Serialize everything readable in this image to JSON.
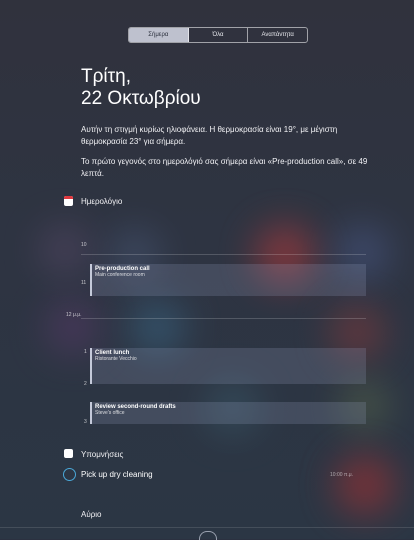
{
  "tabs": [
    {
      "label": "Σήμερα",
      "active": true
    },
    {
      "label": "Όλα",
      "active": false
    },
    {
      "label": "Αναπάντητα",
      "active": false
    }
  ],
  "date": {
    "weekday": "Τρίτη,",
    "day_month": "22 Οκτωβρίου"
  },
  "summary": {
    "weather": "Αυτήν τη στιγμή κυρίως ηλιοφάνεια. Η θερμοκρασία είναι 19°, με μέγιστη θερμοκρασία 23° για σήμερα.",
    "calendar": "Το πρώτο γεγονός στο ημερολόγιό σας σήμερα είναι «Pre-production call», σε 49 λεπτά."
  },
  "calendar": {
    "title": "Ημερολόγιο",
    "icon": "calendar-icon",
    "hours": [
      "10",
      "11",
      "12 μ.μ.",
      "1",
      "2",
      "3"
    ],
    "events": [
      {
        "title": "Pre-production call",
        "location": "Main conference room"
      },
      {
        "title": "Client lunch",
        "location": "Ristorante Vecchio"
      },
      {
        "title": "Review second-round drafts",
        "location": "Steve's office"
      }
    ]
  },
  "reminders": {
    "title": "Υπομνήσεις",
    "icon": "reminders-icon",
    "items": [
      {
        "text": "Pick up dry cleaning",
        "time": "10:00 π.μ."
      }
    ]
  },
  "tomorrow": {
    "title": "Αύριο"
  },
  "colors": {
    "calendar_red": "#e0383e",
    "reminder_circle": "#4aa8d8"
  }
}
